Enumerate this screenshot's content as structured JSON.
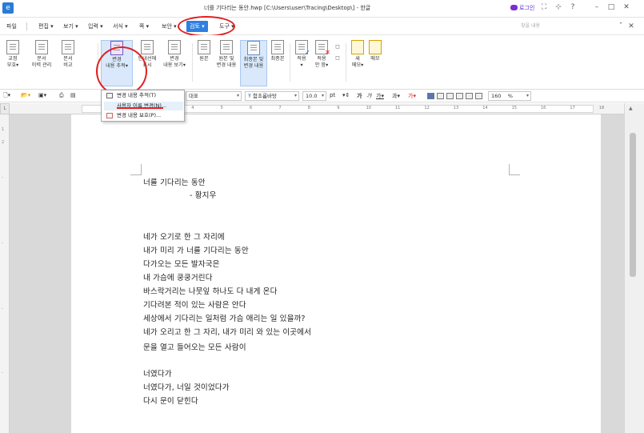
{
  "window": {
    "title": "너를 기다리는 동안.hwp [C:\\Users\\user\\Tracing\\Desktop\\] - 한글",
    "login_label": "로그인",
    "logo": "e"
  },
  "menu": {
    "items": [
      {
        "label": "파일"
      },
      {
        "label": "편집 ▾"
      },
      {
        "label": "보기 ▾"
      },
      {
        "label": "입력 ▾"
      },
      {
        "label": "서식 ▾"
      },
      {
        "label": "쪽 ▾"
      },
      {
        "label": "보안 ▾"
      },
      {
        "label": "검토 ▾"
      },
      {
        "label": "도구 ▾"
      }
    ],
    "search_placeholder": "찾을 내용"
  },
  "ribbon": {
    "buttons": [
      {
        "line1": "교정",
        "line2": "부호▾"
      },
      {
        "line1": "문서",
        "line2": "이력 관리"
      },
      {
        "line1": "문서",
        "line2": "비교"
      },
      {
        "line1": "변경",
        "line2": "내용 추적▾"
      },
      {
        "line1": "안내선에",
        "line2": "표시"
      },
      {
        "line1": "변경",
        "line2": "내용 보기▾"
      },
      {
        "line1": "원본",
        "line2": ""
      },
      {
        "line1": "원본 및",
        "line2": "변경 내용"
      },
      {
        "line1": "최종본 및",
        "line2": "변경 내용"
      },
      {
        "line1": "최종본",
        "line2": ""
      },
      {
        "line1": "적용",
        "line2": "▾"
      },
      {
        "line1": "적용",
        "line2": "안 함▾"
      },
      {
        "line1": "새",
        "line2": "메모▾"
      },
      {
        "line1": "메모",
        "line2": ""
      }
    ]
  },
  "format": {
    "style": "대표",
    "font": "함초롬바탕",
    "size": "10.0",
    "unit": "pt",
    "zoom": "160",
    "zoom_unit": "%"
  },
  "dropdown": {
    "items": [
      {
        "label": "변경 내용 추적(T)"
      },
      {
        "label": "사용자 이름 변경(N)..."
      },
      {
        "label": "변경 내용 보호(P)..."
      }
    ]
  },
  "document": {
    "lines": [
      "너를 기다리는 동안",
      "- 황지우",
      "네가 오기로 한 그 자리에",
      "내가 미리 가 너를 기다리는 동안",
      "다가오는 모든 발자국은",
      "내 가슴에 쿵쿵거린다",
      "바스락거리는 나뭇잎 하나도 다 내게 온다",
      "기다려본 적이 있는 사람은 안다",
      "세상에서 기다리는 일처럼 가슴 애리는 일 있을까?",
      "네가 오리고 한 그 자리, 내가 미리 와 있는 이곳에서",
      "문을 열고 들어오는 모든 사람이",
      "너였다가",
      "너였다가, 너일 것이었다가",
      "다시 문이 닫힌다"
    ]
  },
  "ruler_numbers": [
    "1",
    "2",
    "3",
    "4",
    "5",
    "6",
    "7",
    "8",
    "9",
    "10",
    "11",
    "12",
    "13",
    "14",
    "15",
    "16",
    "17",
    "18"
  ],
  "colors": {
    "accent": "#2f7fe0",
    "annotation": "#e0201f"
  }
}
